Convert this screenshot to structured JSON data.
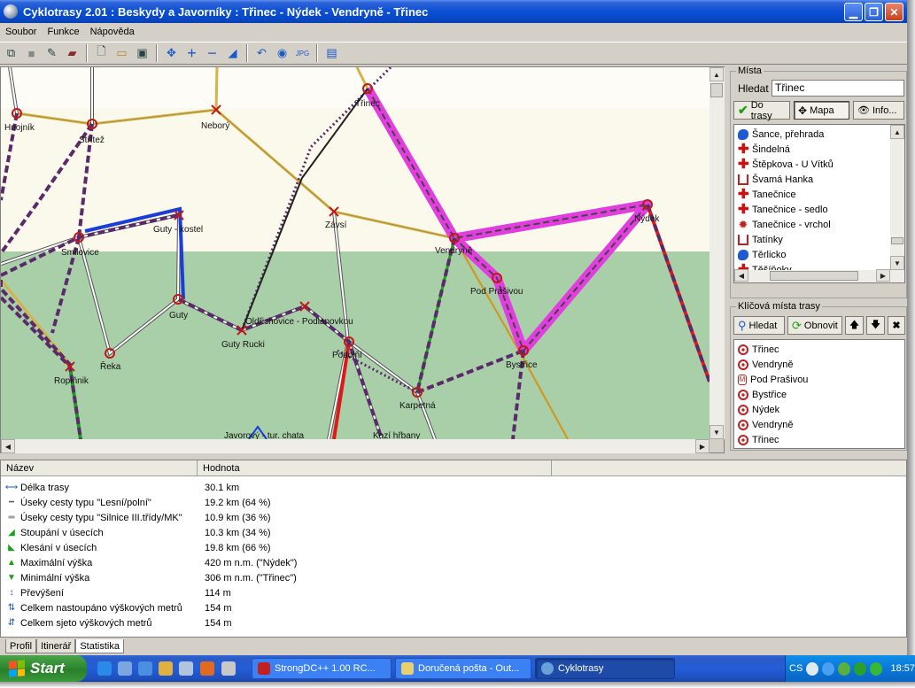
{
  "window": {
    "title": "Cyklotrasy 2.01 : Beskydy a Javorníky : Třinec - Nýdek - Vendryně - Třinec",
    "buttons": [
      "minimize",
      "maximize",
      "close"
    ]
  },
  "menu": [
    "Soubor",
    "Funkce",
    "Nápověda"
  ],
  "toolbar_icons": [
    "copy-icon",
    "stop-icon",
    "pencil-icon",
    "book-icon",
    "new-document-icon",
    "open-folder-icon",
    "save-icon",
    "move-icon",
    "zoom-in-icon",
    "zoom-out-icon",
    "profile-icon",
    "undo-icon",
    "record-icon",
    "export-jpeg-icon",
    "help-book-icon"
  ],
  "map": {
    "colors": {
      "lowland": "#fbf8ec",
      "forest": "#a9cfa9",
      "route": "#e23ddf",
      "road_yellow": "#d4b34a"
    },
    "labels": [
      "Hnojník",
      "Střítež",
      "Neborý",
      "Třinec",
      "Nýdek",
      "Guty - kostel",
      "Smilovice",
      "Závsí",
      "Vendryně",
      "Pod Prašivou",
      "Guty",
      "Oldřichovice - Podlanovkou",
      "Guty Rucki",
      "Řeka",
      "Podolňí",
      "Bystřice",
      "Ropiňnik",
      "Karpetná",
      "Javorový - tur. chata",
      "Kozí hřbany"
    ]
  },
  "places": {
    "group_label": "Místa",
    "search_label": "Hledat",
    "search_value": "Třinec",
    "btn_to_route": "Do trasy",
    "btn_map": "Mapa",
    "btn_info": "Info...",
    "items": [
      {
        "label": "Šance, přehrada",
        "icon": "water-icon"
      },
      {
        "label": "Šindelná",
        "icon": "cross-icon"
      },
      {
        "label": "Štěpkova - U Vítků",
        "icon": "cross-icon"
      },
      {
        "label": "Švamá Hanka",
        "icon": "house-icon"
      },
      {
        "label": "Tanečnice",
        "icon": "cross-icon"
      },
      {
        "label": "Tanečnice - sedlo",
        "icon": "cross-icon"
      },
      {
        "label": "Tanečnice - vrchol",
        "icon": "peak-icon"
      },
      {
        "label": "Tatínky",
        "icon": "house-icon"
      },
      {
        "label": "Těrlicko",
        "icon": "water-icon"
      },
      {
        "label": "Těšíňoky",
        "icon": "cross-icon"
      }
    ]
  },
  "key_places": {
    "group_label": "Klíčová místa trasy",
    "btn_search": "Hledat",
    "btn_refresh": "Obnovit",
    "items": [
      "Třinec",
      "Vendryně",
      "Pod Prašivou",
      "Bystřice",
      "Nýdek",
      "Vendryně",
      "Třinec"
    ]
  },
  "stats": {
    "col_name": "Název",
    "col_value": "Hodnota",
    "rows": [
      {
        "name": "Délka trasy",
        "value": "30.1 km",
        "icon": "length-icon"
      },
      {
        "name": "Úseky cesty typu \"Lesní/polní\"",
        "value": "19.2 km (64 %)",
        "icon": "dashed-path-icon"
      },
      {
        "name": "Úseky cesty typu \"Silnice III.třídy/MK\"",
        "value": "10.9 km (36 %)",
        "icon": "road-icon"
      },
      {
        "name": "Stoupání v úsecích",
        "value": "10.3 km (34 %)",
        "icon": "ascent-icon"
      },
      {
        "name": "Klesání v úsecích",
        "value": "19.8 km (66 %)",
        "icon": "descent-icon"
      },
      {
        "name": "Maximální výška",
        "value": "420 m n.m. (\"Nýdek\")",
        "icon": "max-height-icon"
      },
      {
        "name": "Minimální výška",
        "value": "306 m n.m. (\"Třinec\")",
        "icon": "min-height-icon"
      },
      {
        "name": "Převýšení",
        "value": "114 m",
        "icon": "elevation-diff-icon"
      },
      {
        "name": "Celkem nastoupáno výškových metrů",
        "value": "154 m",
        "icon": "total-ascent-icon"
      },
      {
        "name": "Celkem sjeto výškových metrů",
        "value": "154 m",
        "icon": "total-descent-icon"
      }
    ]
  },
  "tabs": [
    "Profil",
    "Itinerář",
    "Statistika"
  ],
  "taskbar": {
    "start": "Start",
    "tasks": [
      "StrongDC++ 1.00 RC...",
      "Doručená pošta - Out...",
      "Cyklotrasy"
    ],
    "lang": "CS",
    "clock": "18:57"
  }
}
